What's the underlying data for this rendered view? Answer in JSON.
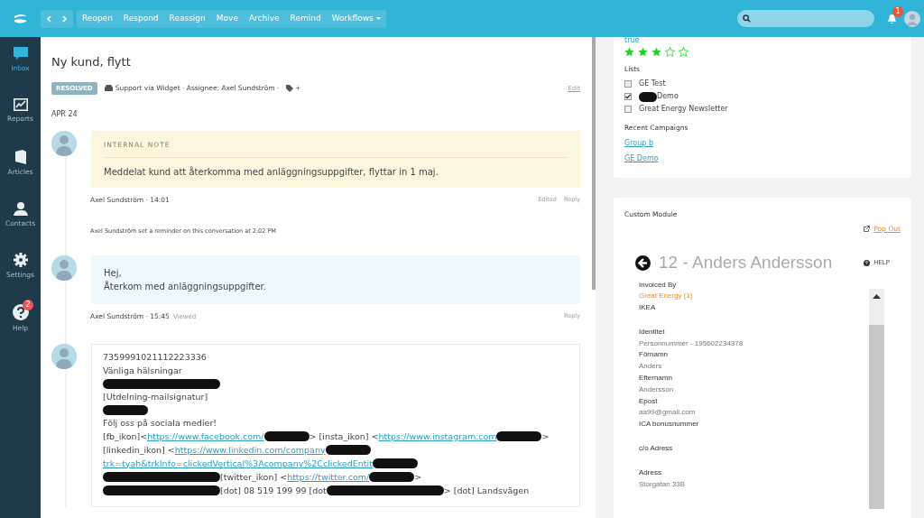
{
  "topbar": {
    "actions": [
      "Reopen",
      "Respond",
      "Reassign",
      "Move",
      "Archive",
      "Remind",
      "Workflows"
    ],
    "notification_count": "1"
  },
  "sidebar": {
    "items": [
      {
        "label": "Inbox",
        "selected": true
      },
      {
        "label": "Reports",
        "selected": false
      },
      {
        "label": "Articles",
        "selected": false
      },
      {
        "label": "Contacts",
        "selected": false
      },
      {
        "label": "Settings",
        "selected": false
      },
      {
        "label": "Help",
        "selected": false,
        "badge": "2"
      }
    ]
  },
  "conversation": {
    "title": "Ny kund, flytt",
    "status": "RESOLVED",
    "meta": "Support via Widget · Assignee: Axel Sundström ·",
    "tag_count": "+",
    "edit": "Edit",
    "date": "APR 24",
    "thread": [
      {
        "kind": "note",
        "heading": "INTERNAL NOTE",
        "body": "Meddelat kund att återkomma med anläggningsuppgifter, flyttar in 1 maj.",
        "author": "Axel Sundström · 14:01",
        "actions": [
          "Edited",
          "Reply"
        ]
      },
      {
        "kind": "event",
        "text": "Axel Sundström set a reminder on this conversation at 2:02 PM"
      },
      {
        "kind": "message",
        "lines": [
          "Hej,",
          "Återkom med anläggningsuppgifter."
        ],
        "author": "Axel Sundström · 15:45",
        "viewed": "Viewed",
        "actions": [
          "Reply"
        ]
      },
      {
        "kind": "email",
        "lines": [
          [
            {
              "kind": "text",
              "text": "7359991021112223336"
            }
          ],
          [
            {
              "kind": "text",
              "text": "Vänliga hälsningar"
            }
          ],
          [
            {
              "kind": "redacted_wide"
            }
          ],
          [
            {
              "kind": "text",
              "text": "[Utdelning-mailsignatur]"
            }
          ],
          [
            {
              "kind": "redacted"
            }
          ],
          [
            {
              "kind": "text",
              "text": "Följ oss på sociala medier!"
            }
          ],
          [
            {
              "kind": "text",
              "text": "[fb_ikon]<"
            },
            {
              "kind": "link",
              "text": "https://www.facebook.com/"
            },
            {
              "kind": "redacted"
            },
            {
              "kind": "text",
              "text": "> [insta_ikon] <"
            },
            {
              "kind": "link",
              "text": "https://www.instagram.com"
            },
            {
              "kind": "redacted"
            },
            {
              "kind": "text",
              "text": ">"
            }
          ],
          [
            {
              "kind": "text",
              "text": "[linkedin_ikon] <"
            },
            {
              "kind": "link",
              "text": "https://www.linkedin.com/company"
            },
            {
              "kind": "redacted"
            }
          ],
          [
            {
              "kind": "link",
              "text": "trk=tyah&trkInfo=clickedVertical%3Acompany%2CclickedEntit"
            },
            {
              "kind": "redacted"
            }
          ],
          [
            {
              "kind": "redacted_wide"
            },
            {
              "kind": "text",
              "text": "[twitter_ikon] <"
            },
            {
              "kind": "link",
              "text": "https://twitter.com/"
            },
            {
              "kind": "redacted"
            },
            {
              "kind": "text",
              "text": ">"
            }
          ],
          [
            {
              "kind": "redacted_wide"
            },
            {
              "kind": "text",
              "text": "[dot] 08 519 199 99 [dot"
            },
            {
              "kind": "redacted_wide"
            },
            {
              "kind": "text",
              "text": "> [dot] Landsvägen"
            }
          ]
        ]
      }
    ]
  },
  "contact": {
    "field_value": "true",
    "stars": 3,
    "lists_heading": "Lists",
    "lists": [
      {
        "label": "GE Test",
        "checked": false,
        "redacted": false
      },
      {
        "label": "Demo",
        "checked": true,
        "redacted": true
      },
      {
        "label": "Great Energy Newsletter",
        "checked": false,
        "redacted": false
      }
    ],
    "campaigns_heading": "Recent Campaigns",
    "campaigns": [
      "Group b",
      "GE Demo"
    ]
  },
  "module": {
    "title": "Custom Module",
    "popout": "Pop Out",
    "heading": "12 - Anders Andersson",
    "help": "HELP",
    "fields": [
      {
        "kind": "label",
        "text": "Invoiced By"
      },
      {
        "kind": "link",
        "text": "Great Energy (1)"
      },
      {
        "kind": "label",
        "text": "IKEA"
      },
      {
        "kind": "label",
        "text": "Identitet",
        "gap": true
      },
      {
        "kind": "value",
        "text": "Personnummer - 195602234378"
      },
      {
        "kind": "label",
        "text": "Förnamn"
      },
      {
        "kind": "value",
        "text": "Anders"
      },
      {
        "kind": "label",
        "text": "Efternamn"
      },
      {
        "kind": "value",
        "text": "Andersson"
      },
      {
        "kind": "label",
        "text": "Epost"
      },
      {
        "kind": "value",
        "text": "aa99@gmail.com"
      },
      {
        "kind": "label",
        "text": "ICA bonusnummer"
      },
      {
        "kind": "label",
        "text": "c/o Adress",
        "gap": true
      },
      {
        "kind": "label",
        "text": "Adress",
        "gap": true
      },
      {
        "kind": "value",
        "text": "Storgatan 33B"
      }
    ]
  }
}
